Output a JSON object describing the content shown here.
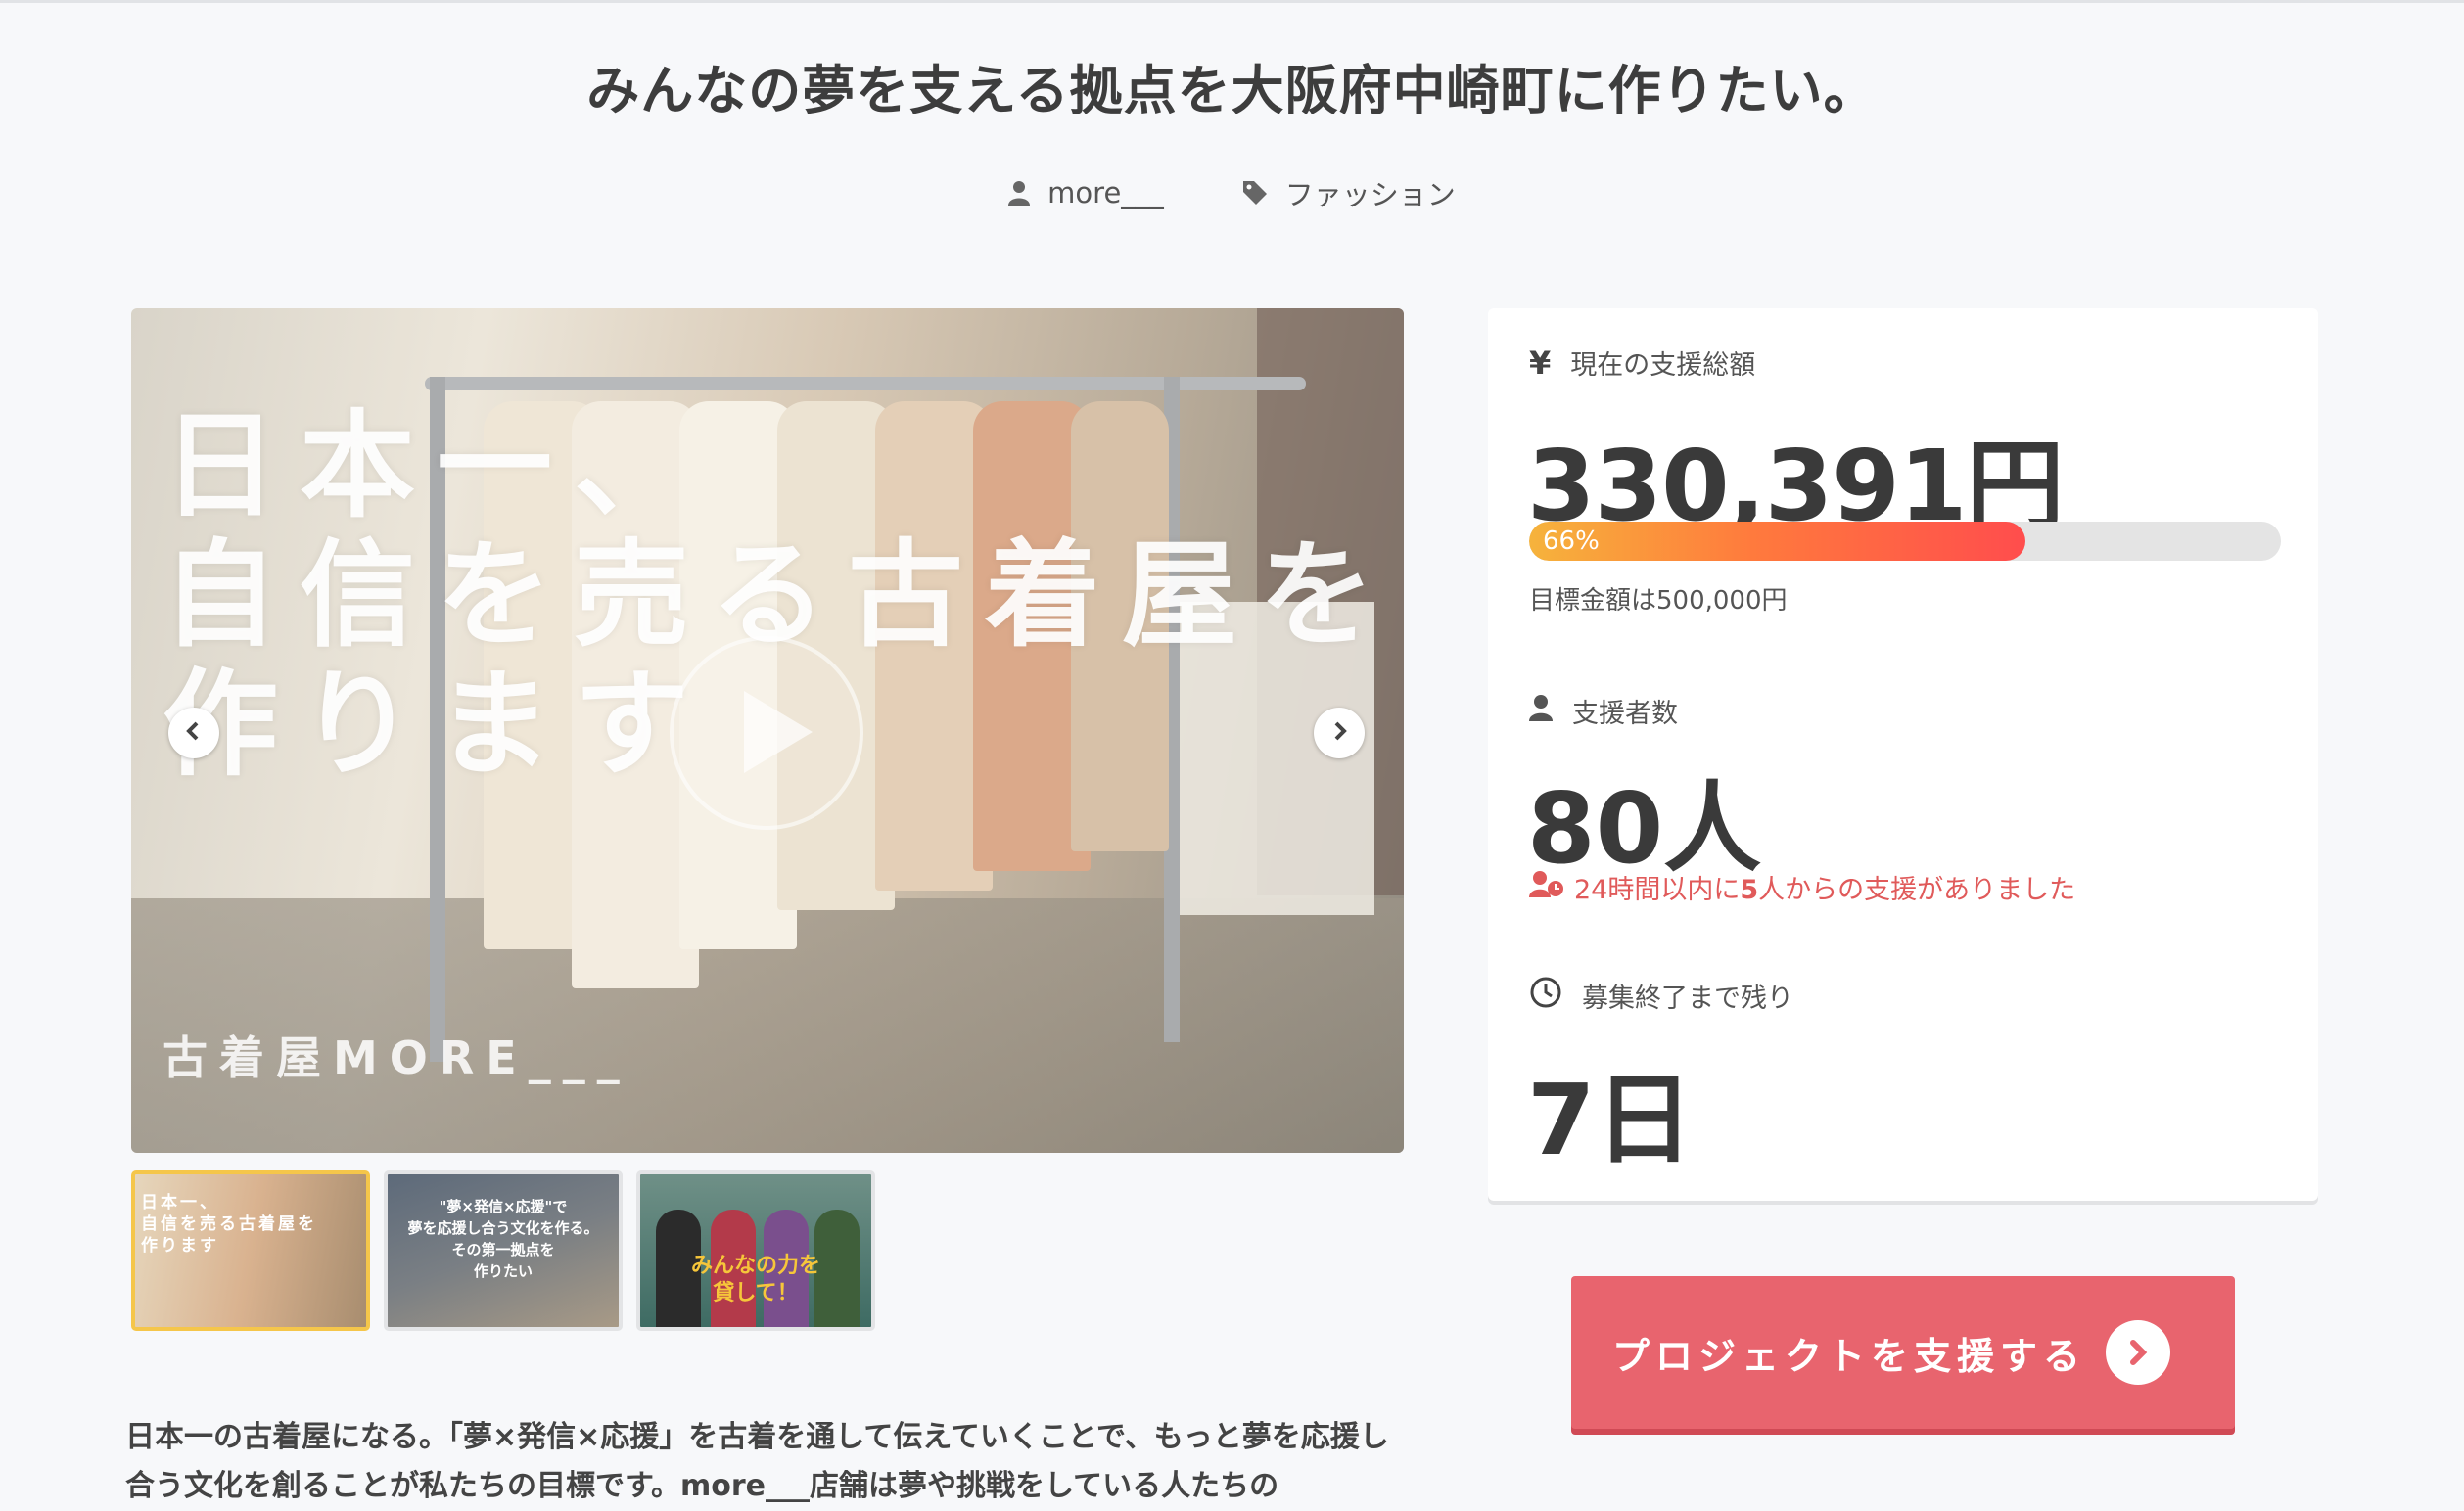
{
  "project": {
    "title": "みんなの夢を支える拠点を大阪府中崎町に作りたい。",
    "owner": "more___",
    "category": "ファッション"
  },
  "hero": {
    "overlay_text": "日本一、\n自信を売る古着屋を\n作ります",
    "shop_name": "古着屋MORE___"
  },
  "thumbnails": [
    {
      "text": "日本一、\n自信を売る古着屋を\n作ります",
      "active": true
    },
    {
      "text": "\"夢×発信×応援\"で\n夢を応援し合う文化を作る。\nその第一拠点を\n作りたい",
      "active": false
    },
    {
      "text": "みんなの力を\n貸して！",
      "active": false
    }
  ],
  "description": "日本一の古着屋になる。「夢×発信×応援」を古着を通して伝えていくことで、もっと夢を応援し合う文化を創ることが私たちの目標です。more___店舗は夢や挑戦をしている人たちの",
  "stats": {
    "amount_label": "現在の支援総額",
    "amount": "330,391円",
    "progress_percent": 66,
    "progress_text": "66%",
    "goal_text": "目標金額は500,000円",
    "backers_label": "支援者数",
    "backers": "80人",
    "recent_prefix": "24時間以内に",
    "recent_count": "5",
    "recent_suffix": "人からの支援がありました",
    "remaining_label": "募集終了まで残り",
    "remaining": "7日"
  },
  "cta": {
    "label": "プロジェクトを支援する"
  },
  "colors": {
    "accent": "#e8646e",
    "recent": "#e05a5a",
    "thumb_active": "#f5c64a"
  }
}
